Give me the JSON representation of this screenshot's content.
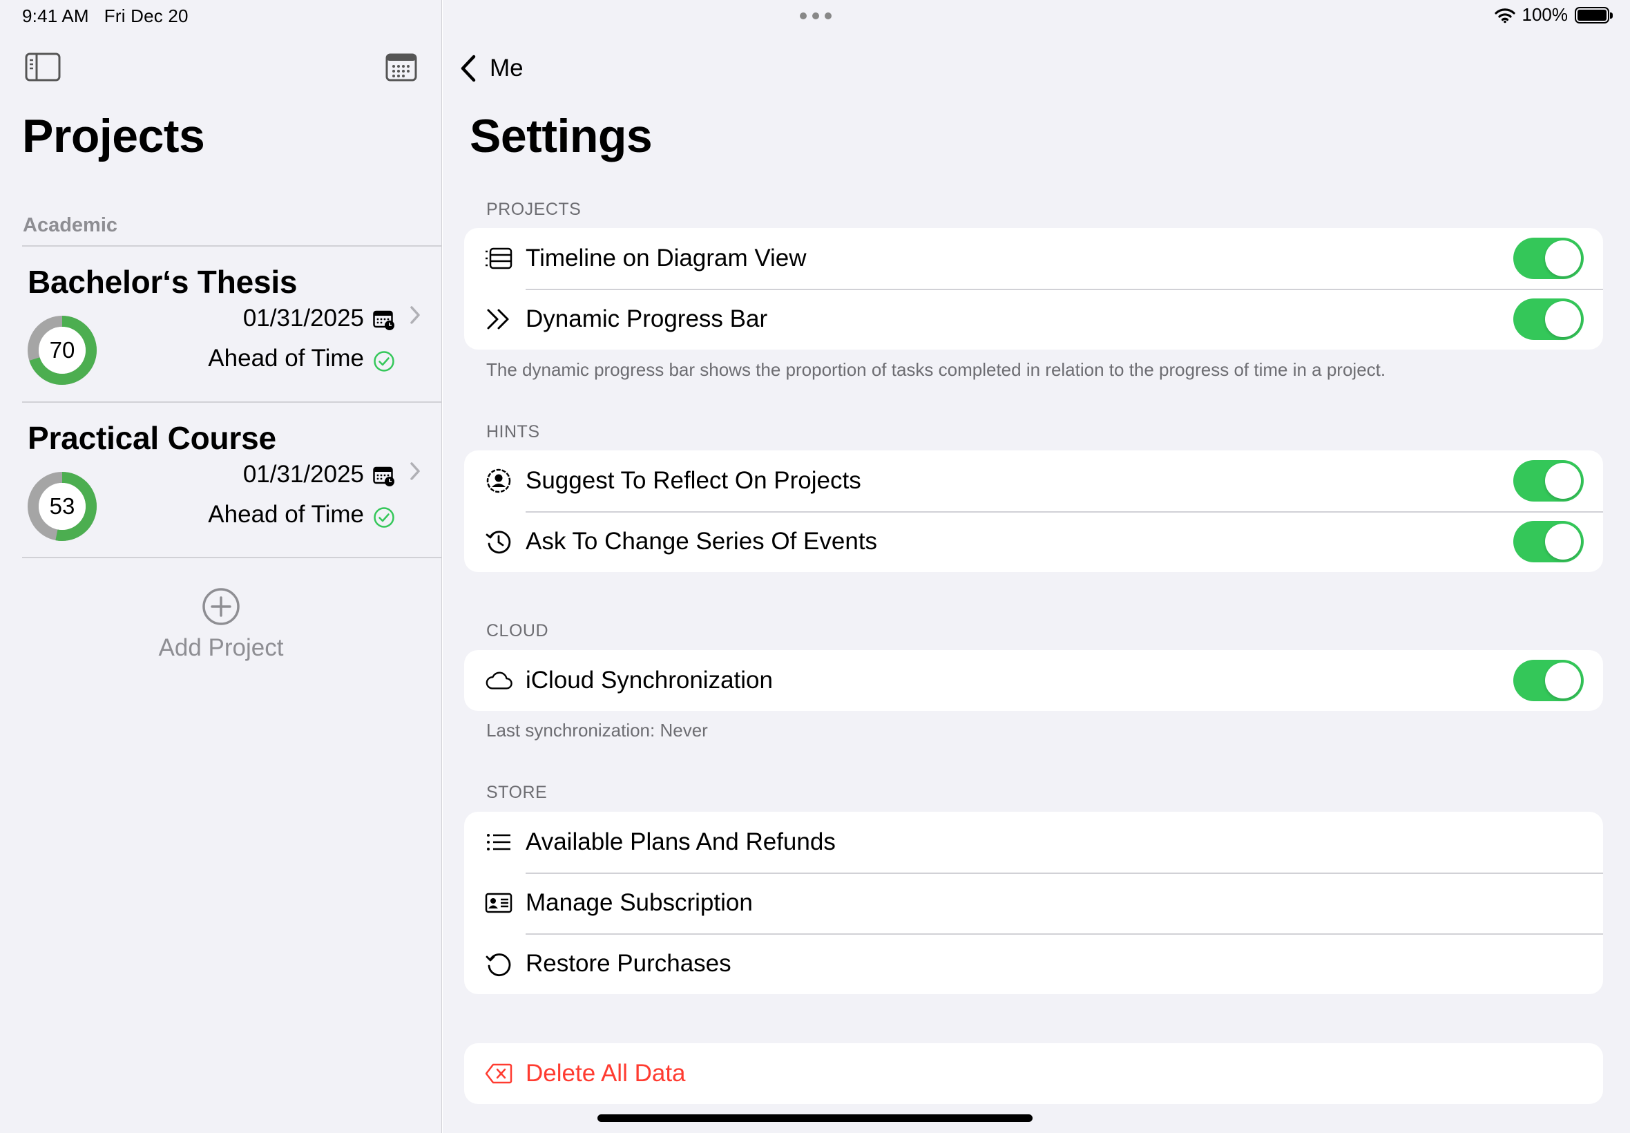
{
  "status_bar": {
    "time": "9:41 AM",
    "date": "Fri Dec 20",
    "battery": "100%"
  },
  "sidebar": {
    "title": "Projects",
    "section": "Academic",
    "projects": [
      {
        "name": "Bachelor‘s Thesis",
        "progress": 70,
        "progress_label": "70",
        "date": "01/31/2025",
        "status": "Ahead of Time"
      },
      {
        "name": "Practical Course",
        "progress": 53,
        "progress_label": "53",
        "date": "01/31/2025",
        "status": "Ahead of Time"
      }
    ],
    "add_project": "Add Project"
  },
  "main": {
    "back_label": "Me",
    "title": "Settings",
    "groups": {
      "projects": {
        "header": "PROJECTS",
        "rows": [
          {
            "label": "Timeline on Diagram View",
            "on": true
          },
          {
            "label": "Dynamic Progress Bar",
            "on": true
          }
        ],
        "footer": "The dynamic progress bar shows the proportion of tasks completed in relation to the progress of time in a project."
      },
      "hints": {
        "header": "HINTS",
        "rows": [
          {
            "label": "Suggest To Reflect On Projects",
            "on": true
          },
          {
            "label": "Ask To Change Series Of Events",
            "on": true
          }
        ]
      },
      "cloud": {
        "header": "CLOUD",
        "rows": [
          {
            "label": "iCloud Synchronization",
            "on": true
          }
        ],
        "footer": "Last synchronization: Never"
      },
      "store": {
        "header": "STORE",
        "rows": [
          {
            "label": "Available Plans And Refunds"
          },
          {
            "label": "Manage Subscription"
          },
          {
            "label": "Restore Purchases"
          }
        ]
      },
      "danger": {
        "rows": [
          {
            "label": "Delete All Data"
          }
        ]
      }
    }
  },
  "colors": {
    "accent_green": "#34c759",
    "progress_green": "#4cae50",
    "ring_track": "#a5a5a5",
    "destructive": "#ff3b30",
    "background": "#f2f2f7"
  },
  "icons": [
    "sidebar-toggle-icon",
    "calendar-icon",
    "chevron-left-icon",
    "timeline-icon",
    "double-chevron-icon",
    "person-circle-icon",
    "clock-arrow-icon",
    "cloud-icon",
    "list-icon",
    "id-card-icon",
    "restore-icon",
    "delete-icon",
    "plus-circle-icon",
    "checkmark-circle-icon",
    "chevron-right-icon",
    "wifi-icon",
    "battery-icon"
  ]
}
